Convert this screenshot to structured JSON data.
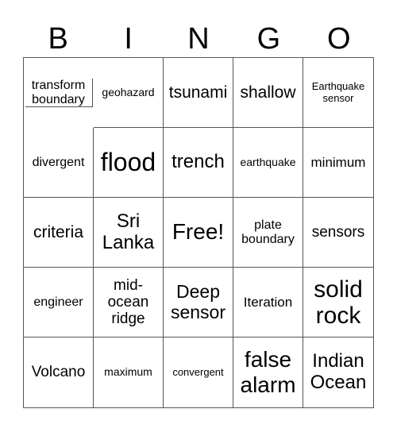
{
  "header": [
    "B",
    "I",
    "N",
    "G",
    "O"
  ],
  "cells": [
    "transform boundary",
    "geohazard",
    "tsunami",
    "shallow",
    "Earthquake sensor",
    "divergent",
    "flood",
    "trench",
    "earthquake",
    "minimum",
    "criteria",
    "Sri Lanka",
    "Free!",
    "plate boundary",
    "sensors",
    "engineer",
    "mid-ocean ridge",
    "Deep sensor",
    "Iteration",
    "solid rock",
    "Volcano",
    "maximum",
    "convergent",
    "false alarm",
    "Indian Ocean"
  ]
}
